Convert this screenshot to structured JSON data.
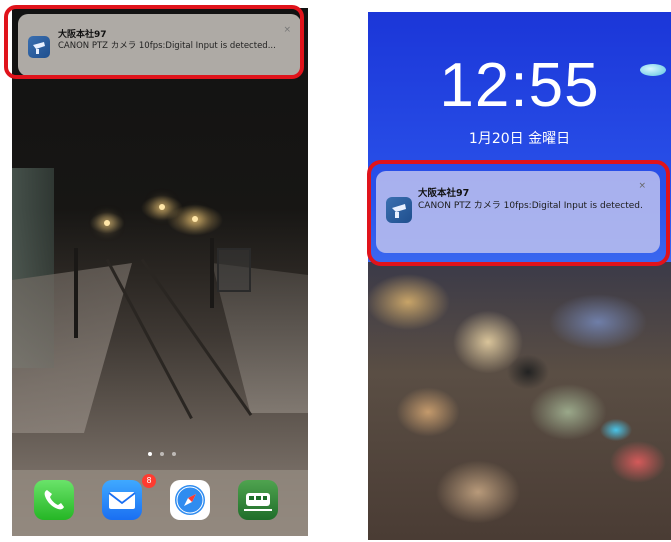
{
  "left_screen": {
    "notification": {
      "title": "大阪本社97",
      "body": "CANON PTZ カメラ 10fps:Digital Input is detected...",
      "close": "×"
    },
    "page_dots": {
      "count": 3,
      "active_index": 0
    },
    "dock": {
      "apps": [
        {
          "name": "Phone",
          "icon": "phone-icon"
        },
        {
          "name": "Mail",
          "icon": "mail-icon",
          "badge": "8"
        },
        {
          "name": "Safari",
          "icon": "compass-icon"
        },
        {
          "name": "Train",
          "icon": "train-icon"
        }
      ]
    }
  },
  "right_screen": {
    "time": "12:55",
    "date": "1月20日 金曜日",
    "notification": {
      "title": "大阪本社97",
      "body": "CANON PTZ カメラ 10fps:Digital Input is detected.",
      "close": "×"
    }
  },
  "colors": {
    "highlight": "#e0131b",
    "lockscreen_bg": "#1b36d8",
    "notification_icon": "#2a5fa0"
  }
}
